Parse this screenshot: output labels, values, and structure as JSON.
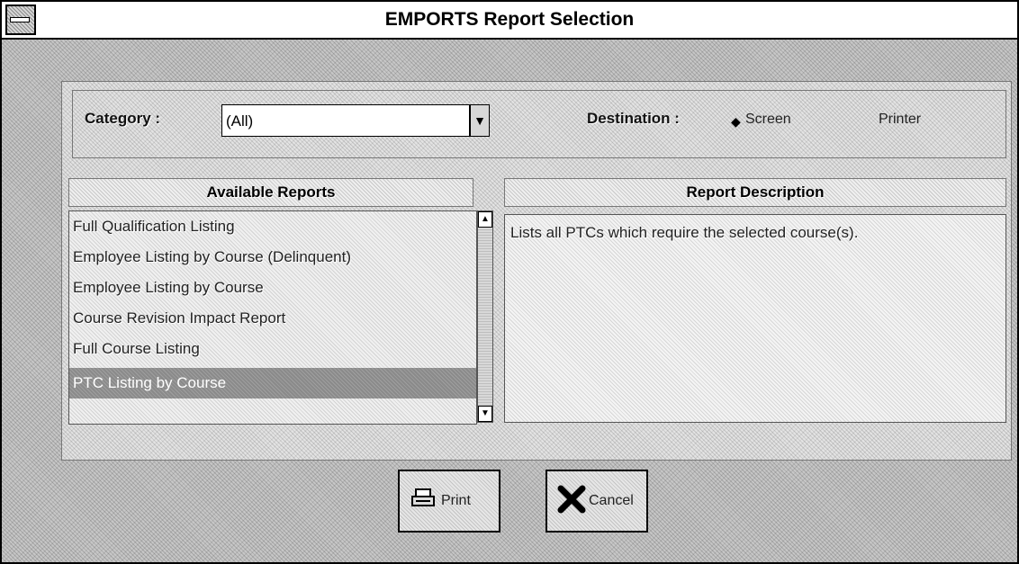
{
  "window": {
    "title": "EMPORTS Report Selection"
  },
  "category": {
    "label": "Category :",
    "value": "(All)"
  },
  "destination": {
    "label": "Destination :",
    "options": [
      "Screen",
      "Printer"
    ],
    "selected": "Screen"
  },
  "available_reports": {
    "header": "Available Reports",
    "items": [
      "Full Qualification Listing",
      "Employee Listing by Course (Delinquent)",
      "Employee Listing by Course",
      "Course Revision Impact Report",
      "Full Course Listing",
      "PTC Listing by Course"
    ],
    "selected_index": 5
  },
  "report_description": {
    "header": "Report Description",
    "text": "Lists all PTCs which require the selected course(s)."
  },
  "buttons": {
    "print": "Print",
    "cancel": "Cancel"
  }
}
